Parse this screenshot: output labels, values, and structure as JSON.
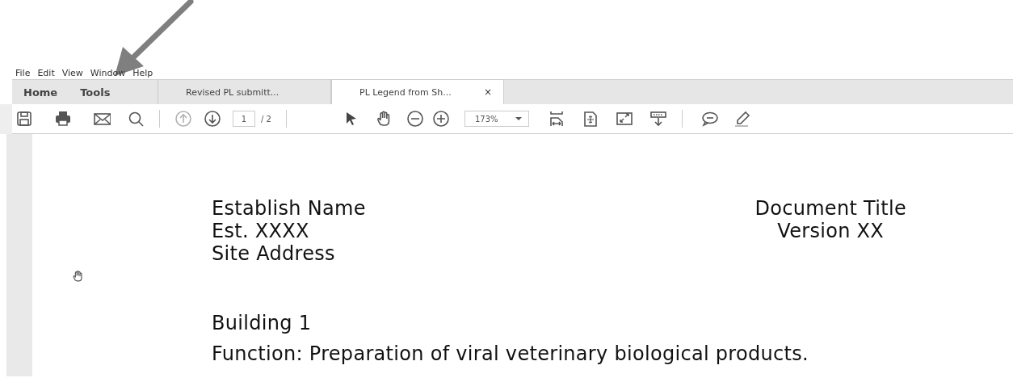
{
  "menu": [
    "File",
    "Edit",
    "View",
    "Window",
    "Help"
  ],
  "tabs": [
    {
      "label": "Home",
      "kind": "nav",
      "selected": false
    },
    {
      "label": "Tools",
      "kind": "nav",
      "selected": false
    },
    {
      "label": "Revised PL submitt...",
      "kind": "document",
      "selected": false
    },
    {
      "label": "PL Legend from Sh...",
      "kind": "document",
      "selected": true,
      "close": "×"
    }
  ],
  "toolbar": {
    "previous_page_disabled": true,
    "page_number": "1",
    "page_count": "/ 2",
    "zoom": "173%"
  },
  "document": {
    "header_left": [
      "Establish Name",
      "Est. XXXX",
      "Site Address"
    ],
    "header_right": [
      "Document Title",
      "Version XX"
    ],
    "heading": "Building 1",
    "body": "Function: Preparation of viral veterinary biological products."
  }
}
